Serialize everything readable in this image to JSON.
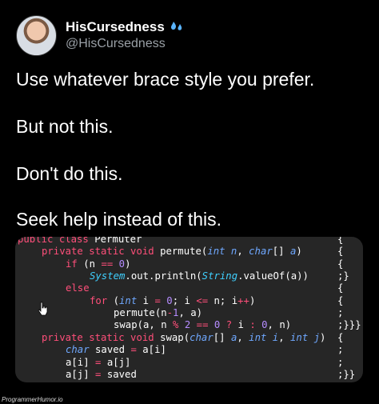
{
  "header": {
    "display_name": "HisCursedness",
    "handle": "@HisCursedness",
    "emoji_icon": "sweat-droplets-icon"
  },
  "tweet": {
    "lines": [
      "Use whatever brace style you prefer.",
      "But not this.",
      "Don't do this.",
      "Seek help instead of this."
    ]
  },
  "code": {
    "lines": [
      "public class Permuter",
      "private static void permute(int n, char[] a)",
      "if (n == 0)",
      "System.out.println(String.valueOf(a))",
      "else",
      "for (int i = 0; i <= n; i++)",
      "permute(n-1, a)",
      "swap(a, n % 2 == 0 ? i : 0, n)",
      "private static void swap(char[] a, int i, int j)",
      "char saved = a[i]",
      "a[i] = a[j]",
      "a[j] = saved"
    ],
    "braces": [
      "{",
      "{",
      "{",
      ";}",
      "{",
      "{",
      ";",
      ";}}}",
      "{",
      ";",
      ";",
      ";}}"
    ]
  },
  "footer": {
    "watermark": "ProgrammerHumor.io"
  },
  "colors": {
    "background": "#000000",
    "code_background": "#262626",
    "keyword": "#ff4f7a",
    "type": "#6fa8ff",
    "class_ref": "#3fd0ff",
    "number": "#b58cff"
  }
}
